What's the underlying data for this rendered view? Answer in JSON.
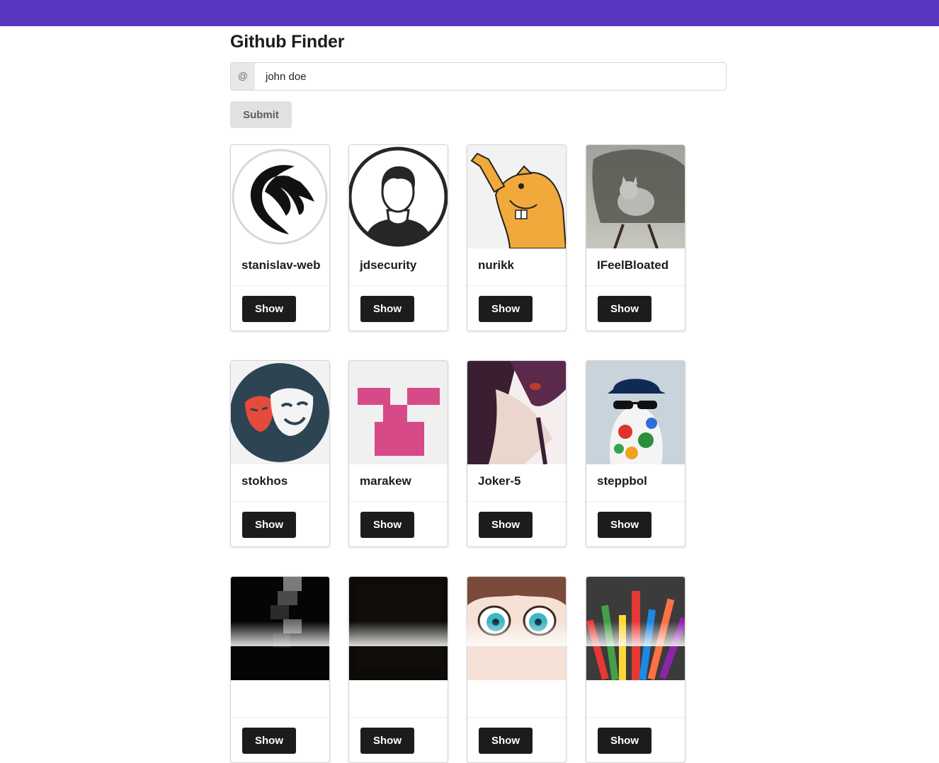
{
  "header": {
    "title": "Github Finder"
  },
  "search": {
    "prefix": "@",
    "value": "john doe"
  },
  "submit_label": "Submit",
  "users": [
    {
      "login": "stanislav-web",
      "avatar": "dragon-icon",
      "button": "Show"
    },
    {
      "login": "jdsecurity",
      "avatar": "person-silhouette-icon",
      "button": "Show"
    },
    {
      "login": "nurikk",
      "avatar": "beaver-cartoon-icon",
      "button": "Show"
    },
    {
      "login": "IFeelBloated",
      "avatar": "cat-photo",
      "button": "Show"
    },
    {
      "login": "stokhos",
      "avatar": "theater-masks-icon",
      "button": "Show"
    },
    {
      "login": "marakew",
      "avatar": "identicon",
      "button": "Show"
    },
    {
      "login": "Joker-5",
      "avatar": "anime-character-photo",
      "button": "Show"
    },
    {
      "login": "steppbol",
      "avatar": "cap-sunglasses-photo",
      "button": "Show"
    },
    {
      "login": "",
      "avatar": "pixelated-dark-photo",
      "button": "Show"
    },
    {
      "login": "",
      "avatar": "black-texture-photo",
      "button": "Show"
    },
    {
      "login": "",
      "avatar": "anime-eyes-photo",
      "button": "Show"
    },
    {
      "login": "",
      "avatar": "colorful-bars-photo",
      "button": "Show"
    }
  ],
  "colors": {
    "topbar": "#5a35bf",
    "show_button": "#1b1c1d",
    "submit_button": "#e0e1e2"
  }
}
